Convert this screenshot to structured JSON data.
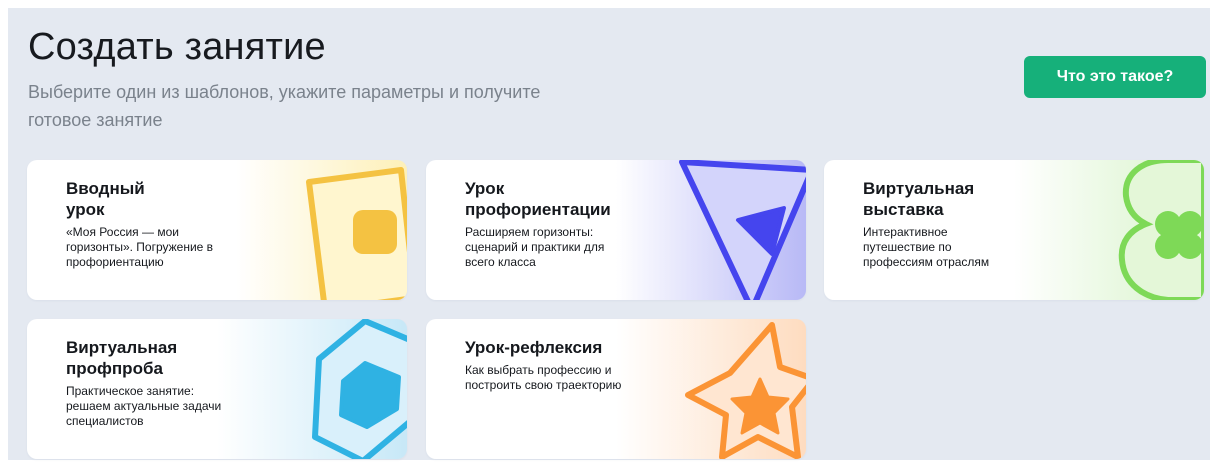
{
  "header": {
    "title": "Создать занятие",
    "subtitle": "Выберите один из шаблонов, укажите параметры и получите готовое занятие",
    "help_button": "Что это такое?"
  },
  "colors": {
    "background": "#e4e9f1",
    "accent_button": "#16b07a",
    "yellow": "#f4c242",
    "purple": "#4545ee",
    "green": "#7ed957",
    "blue": "#2fb2e3",
    "orange": "#fb9435"
  },
  "cards": [
    {
      "title": "Вводный\nурок",
      "description": "«Моя Россия — мои\nгоризонты». Погружение в\nпрофориентацию",
      "icon": "rounded-square-icon"
    },
    {
      "title": "Урок\nпрофориентации",
      "description": "Расширяем горизонты:\nсценарий и практики для\nвсего класса",
      "icon": "triangle-icon"
    },
    {
      "title": "Виртуальная\nвыставка",
      "description": "Интерактивное\nпутешествие по\nпрофессиям отраслям",
      "icon": "clover-icon"
    },
    {
      "title": "Виртуальная\nпрофпроба",
      "description": "Практическое занятие:\nрешаем актуальные задачи\nспециалистов",
      "icon": "hexagon-icon"
    },
    {
      "title": "Урок-рефлексия",
      "description": "Как выбрать профессию и\nпостроить свою траекторию",
      "icon": "star-icon"
    }
  ]
}
